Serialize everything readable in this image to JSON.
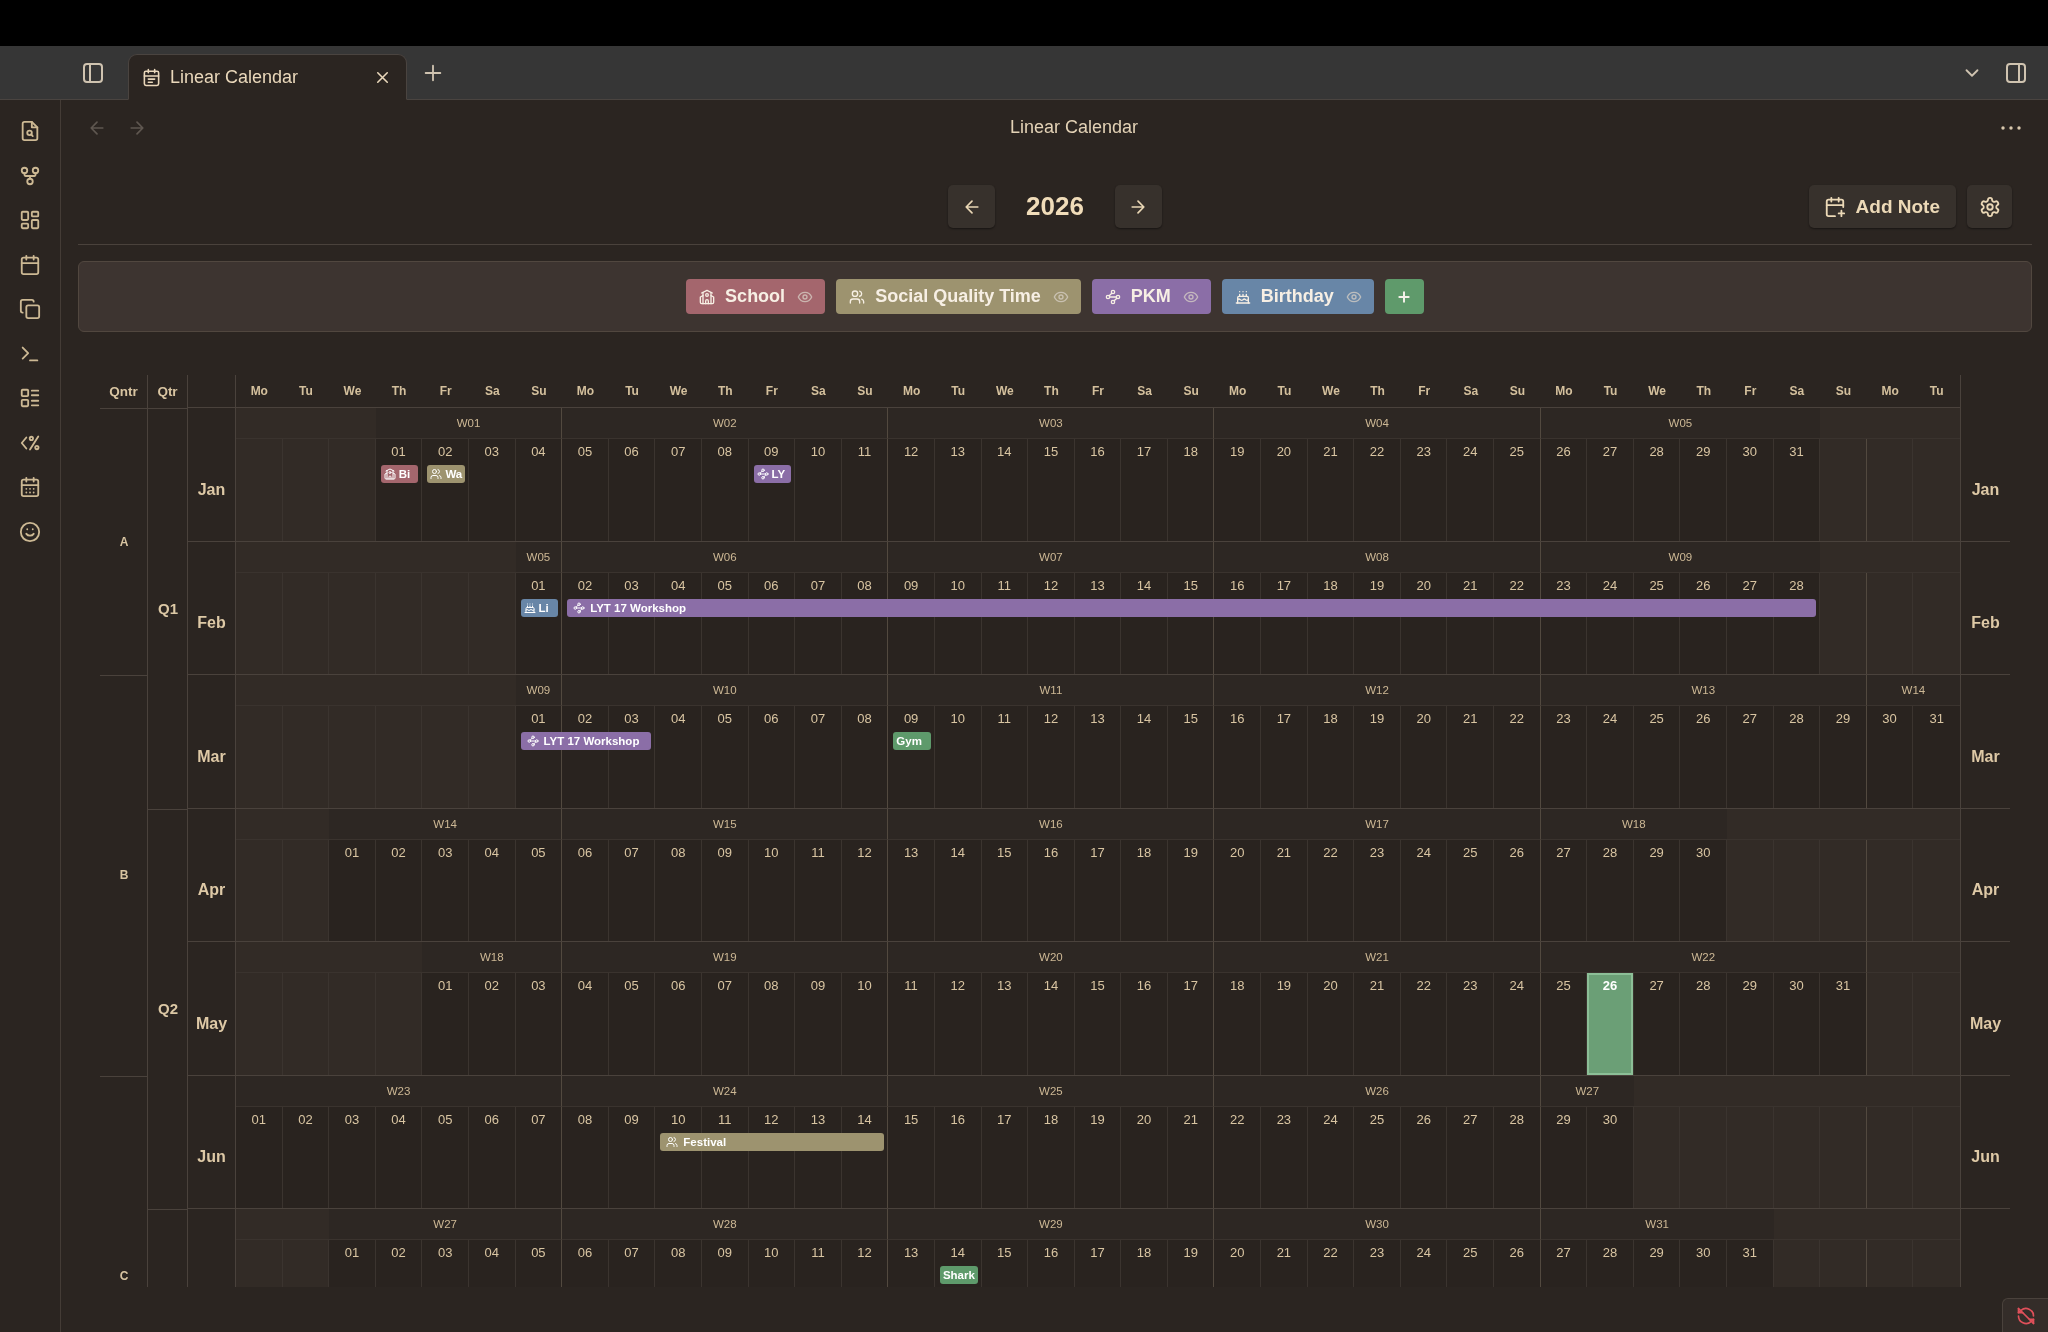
{
  "tab_bar": {
    "tabs": [
      {
        "title": "Linear Calendar",
        "selected": true
      }
    ]
  },
  "view": {
    "title": "Linear Calendar",
    "back": {
      "disabled": true
    },
    "forward": {
      "disabled": true
    }
  },
  "year_nav": {
    "year": "2026"
  },
  "actions": {
    "add_note": "Add Note"
  },
  "categories": [
    {
      "label": "School",
      "kind": "school",
      "color": "#a4666d",
      "visible": true
    },
    {
      "label": "Social Quality Time",
      "kind": "social",
      "color": "#9d936f",
      "visible": true
    },
    {
      "label": "PKM",
      "kind": "pkm",
      "color": "#8b6ea7",
      "visible": true
    },
    {
      "label": "Birthday",
      "kind": "birthday",
      "color": "#6886a7",
      "visible": true
    }
  ],
  "calendar": {
    "column_headers": {
      "qntr": "Qntr",
      "qtr": "Qtr"
    },
    "weekdays": [
      "Mo",
      "Tu",
      "We",
      "Th",
      "Fr",
      "Sa",
      "Su",
      "Mo",
      "Tu",
      "We",
      "Th",
      "Fr",
      "Sa",
      "Su",
      "Mo",
      "Tu",
      "We",
      "Th",
      "Fr",
      "Sa",
      "Su",
      "Mo",
      "Tu",
      "We",
      "Th",
      "Fr",
      "Sa",
      "Su",
      "Mo",
      "Tu",
      "We",
      "Th",
      "Fr",
      "Sa",
      "Su",
      "Mo",
      "Tu"
    ],
    "qntr_labels": [
      "A",
      "B",
      "C"
    ],
    "qtr_labels": [
      "Q1",
      "Q2"
    ],
    "months": [
      {
        "label": "Jan",
        "label_right": "Jan",
        "qntr_start": true,
        "qtr_start": true,
        "weeks": [
          {
            "label": "W01",
            "days": [
              {
                "label": "01",
                "today": false,
                "event": {
                  "label": "Bi",
                  "kind": "school",
                  "color": "#a4666d"
                }
              },
              {
                "label": "02",
                "today": false,
                "event": {
                  "label": "Wa",
                  "kind": "social",
                  "color": "#9d936f"
                }
              },
              {
                "label": "03",
                "today": false
              },
              {
                "label": "04",
                "today": false
              }
            ]
          },
          {
            "label": "W02",
            "days": [
              {
                "label": "05",
                "today": false
              },
              {
                "label": "06",
                "today": false
              },
              {
                "label": "07",
                "today": false
              },
              {
                "label": "08",
                "today": false
              },
              {
                "label": "09",
                "today": false,
                "event": {
                  "label": "LY",
                  "kind": "pkm",
                  "color": "#8b6ea7"
                }
              },
              {
                "label": "10",
                "today": false
              },
              {
                "label": "11",
                "today": false
              }
            ]
          },
          {
            "label": "W03",
            "days": [
              {
                "label": "12",
                "today": false
              },
              {
                "label": "13",
                "today": false
              },
              {
                "label": "14",
                "today": false
              },
              {
                "label": "15",
                "today": false
              },
              {
                "label": "16",
                "today": false
              },
              {
                "label": "17",
                "today": false
              },
              {
                "label": "18",
                "today": false
              }
            ]
          },
          {
            "label": "W04",
            "days": [
              {
                "label": "19",
                "today": false
              },
              {
                "label": "20",
                "today": false
              },
              {
                "label": "21",
                "today": false
              },
              {
                "label": "22",
                "today": false
              },
              {
                "label": "23",
                "today": false
              },
              {
                "label": "24",
                "today": false
              },
              {
                "label": "25",
                "today": false
              }
            ]
          },
          {
            "label": "W05",
            "days": [
              {
                "label": "26",
                "today": false
              },
              {
                "label": "27",
                "today": false
              },
              {
                "label": "28",
                "today": false
              },
              {
                "label": "29",
                "today": false
              },
              {
                "label": "30",
                "today": false
              },
              {
                "label": "31",
                "today": false
              }
            ]
          }
        ]
      },
      {
        "label": "Feb",
        "label_right": "Feb",
        "qntr_start": false,
        "qtr_start": false,
        "weeks": [
          {
            "label": "W05",
            "days": [
              {
                "label": "01",
                "today": false,
                "event": {
                  "label": "Li",
                  "kind": "birthday",
                  "color": "#6886a7"
                }
              }
            ]
          },
          {
            "label": "W06",
            "days": [
              {
                "label": "02",
                "today": false,
                "event": {
                  "label": "LYT 17 Workshop",
                  "kind": "pkm",
                  "color": "#8b6ea7"
                }
              },
              {
                "label": "03",
                "today": false,
                "covered": true
              },
              {
                "label": "04",
                "today": false,
                "covered": true
              },
              {
                "label": "05",
                "today": false,
                "covered": true
              },
              {
                "label": "06",
                "today": false,
                "covered": true
              },
              {
                "label": "07",
                "today": false,
                "covered": true
              },
              {
                "label": "08",
                "today": false,
                "covered": true
              }
            ]
          },
          {
            "label": "W07",
            "days": [
              {
                "label": "09",
                "today": false,
                "covered": true
              },
              {
                "label": "10",
                "today": false,
                "covered": true
              },
              {
                "label": "11",
                "today": false,
                "covered": true
              },
              {
                "label": "12",
                "today": false,
                "covered": true
              },
              {
                "label": "13",
                "today": false,
                "covered": true
              },
              {
                "label": "14",
                "today": false,
                "covered": true
              },
              {
                "label": "15",
                "today": false,
                "covered": true
              }
            ]
          },
          {
            "label": "W08",
            "days": [
              {
                "label": "16",
                "today": false,
                "covered": true
              },
              {
                "label": "17",
                "today": false,
                "covered": true
              },
              {
                "label": "18",
                "today": false,
                "covered": true
              },
              {
                "label": "19",
                "today": false,
                "covered": true
              },
              {
                "label": "20",
                "today": false,
                "covered": true
              },
              {
                "label": "21",
                "today": false,
                "covered": true
              },
              {
                "label": "22",
                "today": false,
                "covered": true
              }
            ]
          },
          {
            "label": "W09",
            "days": [
              {
                "label": "23",
                "today": false,
                "covered": true
              },
              {
                "label": "24",
                "today": false,
                "covered": true
              },
              {
                "label": "25",
                "today": false,
                "covered": true
              },
              {
                "label": "26",
                "today": false,
                "covered": true
              },
              {
                "label": "27",
                "today": false,
                "covered": true
              },
              {
                "label": "28",
                "today": false,
                "covered": true
              }
            ]
          }
        ]
      },
      {
        "label": "Mar",
        "label_right": "Mar",
        "qntr_start": true,
        "qtr_start": false,
        "weeks": [
          {
            "label": "W09",
            "days": [
              {
                "label": "01",
                "today": false,
                "event": {
                  "label": "LYT 17 Workshop",
                  "kind": "pkm",
                  "color": "#8b6ea7"
                }
              }
            ]
          },
          {
            "label": "W10",
            "days": [
              {
                "label": "02",
                "today": false,
                "covered": true
              },
              {
                "label": "03",
                "today": false,
                "covered": true
              },
              {
                "label": "04",
                "today": false
              },
              {
                "label": "05",
                "today": false
              },
              {
                "label": "06",
                "today": false
              },
              {
                "label": "07",
                "today": false
              },
              {
                "label": "08",
                "today": false
              }
            ]
          },
          {
            "label": "W11",
            "days": [
              {
                "label": "09",
                "today": false,
                "event": {
                  "label": "Gym",
                  "kind": "plain",
                  "color": "#5e9a6b"
                }
              },
              {
                "label": "10",
                "today": false
              },
              {
                "label": "11",
                "today": false
              },
              {
                "label": "12",
                "today": false
              },
              {
                "label": "13",
                "today": false
              },
              {
                "label": "14",
                "today": false
              },
              {
                "label": "15",
                "today": false
              }
            ]
          },
          {
            "label": "W12",
            "days": [
              {
                "label": "16",
                "today": false
              },
              {
                "label": "17",
                "today": false
              },
              {
                "label": "18",
                "today": false
              },
              {
                "label": "19",
                "today": false
              },
              {
                "label": "20",
                "today": false
              },
              {
                "label": "21",
                "today": false
              },
              {
                "label": "22",
                "today": false
              }
            ]
          },
          {
            "label": "W13",
            "days": [
              {
                "label": "23",
                "today": false
              },
              {
                "label": "24",
                "today": false
              },
              {
                "label": "25",
                "today": false
              },
              {
                "label": "26",
                "today": false
              },
              {
                "label": "27",
                "today": false
              },
              {
                "label": "28",
                "today": false
              },
              {
                "label": "29",
                "today": false
              }
            ]
          },
          {
            "label": "W14",
            "days": [
              {
                "label": "30",
                "today": false
              },
              {
                "label": "31",
                "today": false
              }
            ]
          }
        ]
      },
      {
        "label": "Apr",
        "label_right": "Apr",
        "qntr_start": false,
        "qtr_start": true,
        "weeks": [
          {
            "label": "W14",
            "days": [
              {
                "label": "01",
                "today": false
              },
              {
                "label": "02",
                "today": false
              },
              {
                "label": "03",
                "today": false
              },
              {
                "label": "04",
                "today": false
              },
              {
                "label": "05",
                "today": false
              }
            ]
          },
          {
            "label": "W15",
            "days": [
              {
                "label": "06",
                "today": false
              },
              {
                "label": "07",
                "today": false
              },
              {
                "label": "08",
                "today": false
              },
              {
                "label": "09",
                "today": false
              },
              {
                "label": "10",
                "today": false
              },
              {
                "label": "11",
                "today": false
              },
              {
                "label": "12",
                "today": false
              }
            ]
          },
          {
            "label": "W16",
            "days": [
              {
                "label": "13",
                "today": false
              },
              {
                "label": "14",
                "today": false
              },
              {
                "label": "15",
                "today": false
              },
              {
                "label": "16",
                "today": false
              },
              {
                "label": "17",
                "today": false
              },
              {
                "label": "18",
                "today": false
              },
              {
                "label": "19",
                "today": false
              }
            ]
          },
          {
            "label": "W17",
            "days": [
              {
                "label": "20",
                "today": false
              },
              {
                "label": "21",
                "today": false
              },
              {
                "label": "22",
                "today": false
              },
              {
                "label": "23",
                "today": false
              },
              {
                "label": "24",
                "today": false
              },
              {
                "label": "25",
                "today": false
              },
              {
                "label": "26",
                "today": false
              }
            ]
          },
          {
            "label": "W18",
            "days": [
              {
                "label": "27",
                "today": false
              },
              {
                "label": "28",
                "today": false
              },
              {
                "label": "29",
                "today": false
              },
              {
                "label": "30",
                "today": false
              }
            ]
          }
        ]
      },
      {
        "label": "May",
        "label_right": "May",
        "qntr_start": false,
        "qtr_start": false,
        "weeks": [
          {
            "label": "W18",
            "days": [
              {
                "label": "01",
                "today": false
              },
              {
                "label": "02",
                "today": false
              },
              {
                "label": "03",
                "today": false
              }
            ]
          },
          {
            "label": "W19",
            "days": [
              {
                "label": "04",
                "today": false
              },
              {
                "label": "05",
                "today": false
              },
              {
                "label": "06",
                "today": false
              },
              {
                "label": "07",
                "today": false
              },
              {
                "label": "08",
                "today": false
              },
              {
                "label": "09",
                "today": false
              },
              {
                "label": "10",
                "today": false
              }
            ]
          },
          {
            "label": "W20",
            "days": [
              {
                "label": "11",
                "today": false
              },
              {
                "label": "12",
                "today": false
              },
              {
                "label": "13",
                "today": false
              },
              {
                "label": "14",
                "today": false
              },
              {
                "label": "15",
                "today": false
              },
              {
                "label": "16",
                "today": false
              },
              {
                "label": "17",
                "today": false
              }
            ]
          },
          {
            "label": "W21",
            "days": [
              {
                "label": "18",
                "today": false
              },
              {
                "label": "19",
                "today": false
              },
              {
                "label": "20",
                "today": false
              },
              {
                "label": "21",
                "today": false
              },
              {
                "label": "22",
                "today": false
              },
              {
                "label": "23",
                "today": false
              },
              {
                "label": "24",
                "today": false
              }
            ]
          },
          {
            "label": "W22",
            "days": [
              {
                "label": "25",
                "today": false
              },
              {
                "label": "26",
                "today": true
              },
              {
                "label": "27",
                "today": false
              },
              {
                "label": "28",
                "today": false
              },
              {
                "label": "29",
                "today": false
              },
              {
                "label": "30",
                "today": false
              },
              {
                "label": "31",
                "today": false
              }
            ]
          }
        ]
      },
      {
        "label": "Jun",
        "label_right": "Jun",
        "qntr_start": true,
        "qtr_start": false,
        "weeks": [
          {
            "label": "W23",
            "days": [
              {
                "label": "01",
                "today": false
              },
              {
                "label": "02",
                "today": false
              },
              {
                "label": "03",
                "today": false
              },
              {
                "label": "04",
                "today": false
              },
              {
                "label": "05",
                "today": false
              },
              {
                "label": "06",
                "today": false
              },
              {
                "label": "07",
                "today": false
              }
            ]
          },
          {
            "label": "W24",
            "days": [
              {
                "label": "08",
                "today": false
              },
              {
                "label": "09",
                "today": false
              },
              {
                "label": "10",
                "today": false,
                "event": {
                  "label": "Festival",
                  "kind": "social",
                  "color": "#9d936f"
                }
              },
              {
                "label": "11",
                "today": false,
                "covered": true
              },
              {
                "label": "12",
                "today": false,
                "covered": true
              },
              {
                "label": "13",
                "today": false,
                "covered": true
              },
              {
                "label": "14",
                "today": false,
                "covered": true
              }
            ]
          },
          {
            "label": "W25",
            "days": [
              {
                "label": "15",
                "today": false
              },
              {
                "label": "16",
                "today": false
              },
              {
                "label": "17",
                "today": false
              },
              {
                "label": "18",
                "today": false
              },
              {
                "label": "19",
                "today": false
              },
              {
                "label": "20",
                "today": false
              },
              {
                "label": "21",
                "today": false
              }
            ]
          },
          {
            "label": "W26",
            "days": [
              {
                "label": "22",
                "today": false
              },
              {
                "label": "23",
                "today": false
              },
              {
                "label": "24",
                "today": false
              },
              {
                "label": "25",
                "today": false
              },
              {
                "label": "26",
                "today": false
              },
              {
                "label": "27",
                "today": false
              },
              {
                "label": "28",
                "today": false
              }
            ]
          },
          {
            "label": "W27",
            "days": [
              {
                "label": "29",
                "today": false
              },
              {
                "label": "30",
                "today": false
              }
            ]
          }
        ]
      },
      {
        "qntr_start": false,
        "qtr_start": true,
        "weeks": [
          {
            "label": "W27",
            "days": [
              {
                "label": "01",
                "today": false
              },
              {
                "label": "02",
                "today": false
              },
              {
                "label": "03",
                "today": false
              },
              {
                "label": "04",
                "today": false
              },
              {
                "label": "05",
                "today": false
              }
            ]
          },
          {
            "label": "W28",
            "days": [
              {
                "label": "06",
                "today": false
              },
              {
                "label": "07",
                "today": false
              },
              {
                "label": "08",
                "today": false
              },
              {
                "label": "09",
                "today": false
              },
              {
                "label": "10",
                "today": false
              },
              {
                "label": "11",
                "today": false
              },
              {
                "label": "12",
                "today": false
              }
            ]
          },
          {
            "label": "W29",
            "days": [
              {
                "label": "13",
                "today": false
              },
              {
                "label": "14",
                "today": false,
                "event": {
                  "label": "Shark",
                  "kind": "plain",
                  "color": "#5e9a6b"
                }
              },
              {
                "label": "15",
                "today": false
              },
              {
                "label": "16",
                "today": false
              },
              {
                "label": "17",
                "today": false
              },
              {
                "label": "18",
                "today": false
              },
              {
                "label": "19",
                "today": false
              }
            ]
          },
          {
            "label": "W30",
            "days": [
              {
                "label": "20",
                "today": false
              },
              {
                "label": "21",
                "today": false
              },
              {
                "label": "22",
                "today": false
              },
              {
                "label": "23",
                "today": false
              },
              {
                "label": "24",
                "today": false
              },
              {
                "label": "25",
                "today": false
              },
              {
                "label": "26",
                "today": false
              }
            ]
          },
          {
            "label": "W31",
            "days": [
              {
                "label": "27",
                "today": false
              },
              {
                "label": "28",
                "today": false
              },
              {
                "label": "29",
                "today": false
              },
              {
                "label": "30",
                "today": false
              },
              {
                "label": "31",
                "today": false
              }
            ]
          }
        ]
      }
    ]
  }
}
